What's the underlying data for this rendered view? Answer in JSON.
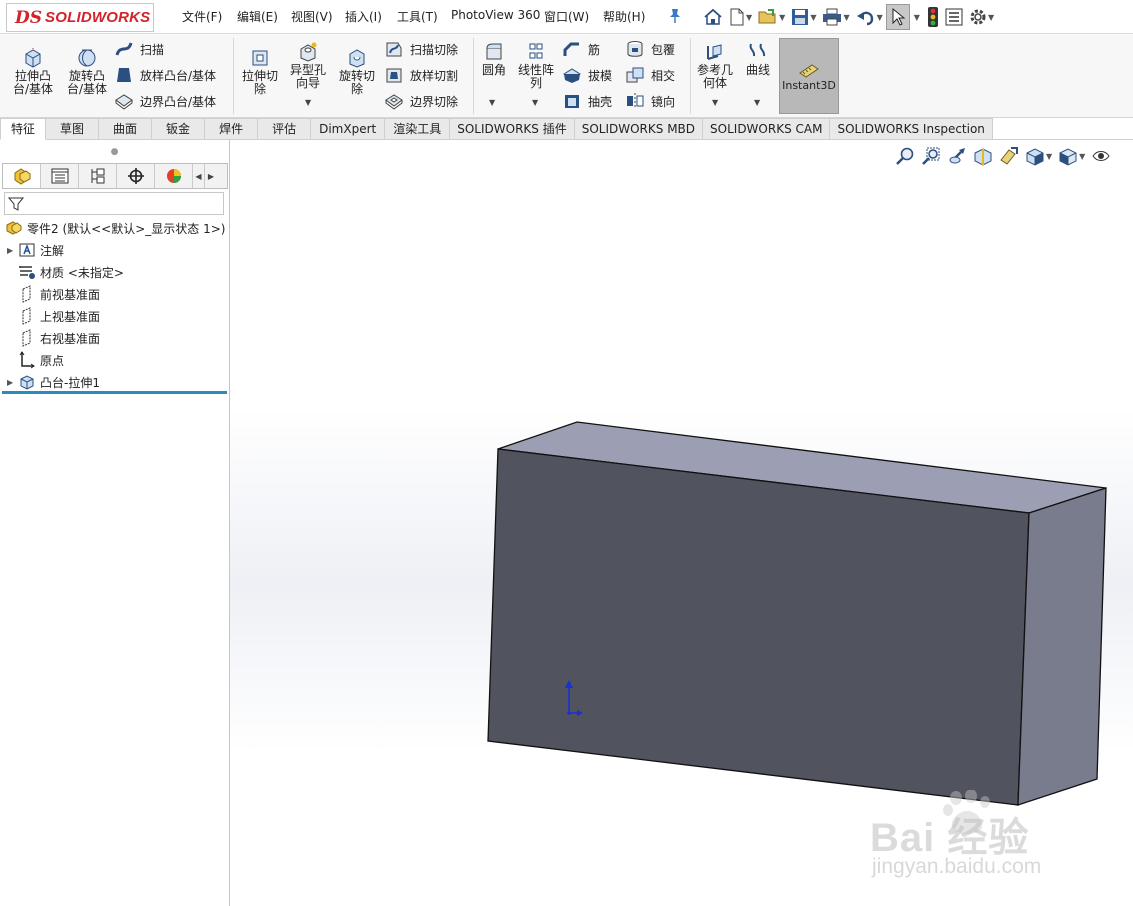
{
  "app": {
    "brand": "SOLIDWORKS",
    "brand_prefix": "DS"
  },
  "menu": [
    {
      "label": "文件(F)"
    },
    {
      "label": "编辑(E)"
    },
    {
      "label": "视图(V)"
    },
    {
      "label": "插入(I)"
    },
    {
      "label": "工具(T)"
    },
    {
      "label": "PhotoView 360"
    },
    {
      "label": "窗口(W)"
    },
    {
      "label": "帮助(H)"
    }
  ],
  "quick_access_icons": [
    "pin-icon",
    "home-icon",
    "new-document-icon",
    "open-folder-icon",
    "save-icon",
    "print-icon",
    "undo-icon",
    "select-cursor-icon",
    "traffic-light-icon",
    "file-properties-icon",
    "options-gear-icon"
  ],
  "ribbon": {
    "extrude_boss": "拉伸凸\n台/基体",
    "revolve_boss": "旋转凸\n台/基体",
    "sweep": "扫描",
    "loft_boss": "放样凸台/基体",
    "boundary_boss": "边界凸台/基体",
    "extrude_cut": "拉伸切\n除",
    "hole_wizard": "异型孔\n向导",
    "revolve_cut": "旋转切\n除",
    "swept_cut": "扫描切除",
    "lofted_cut": "放样切割",
    "boundary_cut": "边界切除",
    "fillet": "圆角",
    "linear_pattern": "线性阵\n列",
    "rib": "筋",
    "draft": "拔模",
    "shell": "抽壳",
    "wrap": "包覆",
    "intersect": "相交",
    "mirror": "镜向",
    "reference_geometry": "参考几\n何体",
    "curves": "曲线",
    "instant3d": "Instant3D"
  },
  "tabs": [
    {
      "label": "特征",
      "active": true
    },
    {
      "label": "草图"
    },
    {
      "label": "曲面"
    },
    {
      "label": "钣金"
    },
    {
      "label": "焊件"
    },
    {
      "label": "评估"
    },
    {
      "label": "DimXpert"
    },
    {
      "label": "渲染工具"
    },
    {
      "label": "SOLIDWORKS 插件"
    },
    {
      "label": "SOLIDWORKS MBD"
    },
    {
      "label": "SOLIDWORKS CAM"
    },
    {
      "label": "SOLIDWORKS Inspection"
    }
  ],
  "feature_tree": {
    "root": "零件2 (默认<<默认>_显示状态 1>)",
    "items": [
      {
        "label": "注解",
        "icon": "annotations-icon",
        "expandable": true
      },
      {
        "label": "材质 <未指定>",
        "icon": "material-icon",
        "expandable": false
      },
      {
        "label": "前视基准面",
        "icon": "plane-icon",
        "expandable": false
      },
      {
        "label": "上视基准面",
        "icon": "plane-icon",
        "expandable": false
      },
      {
        "label": "右视基准面",
        "icon": "plane-icon",
        "expandable": false
      },
      {
        "label": "原点",
        "icon": "origin-icon",
        "expandable": false
      },
      {
        "label": "凸台-拉伸1",
        "icon": "extrude-feature-icon",
        "expandable": true
      }
    ]
  },
  "viewport": {
    "part_colors": {
      "front": "#51535f",
      "top": "#9c9fb3",
      "side": "#797c8d"
    },
    "hud_icons": [
      "zoom-to-fit-icon",
      "zoom-to-area-icon",
      "previous-view-icon",
      "section-view-icon",
      "dynamic-annotation-icon",
      "view-orientation-icon",
      "display-style-icon",
      "hide-show-items-icon"
    ]
  },
  "watermark": {
    "brand": "Bai 经验",
    "url": "jingyan.baidu.com"
  }
}
